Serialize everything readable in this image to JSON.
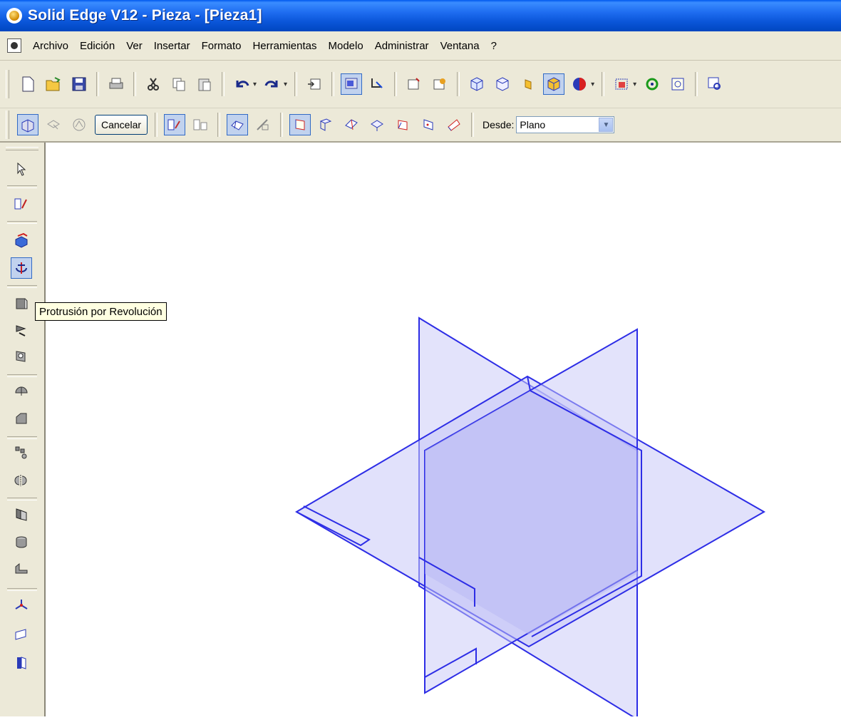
{
  "window": {
    "title": "Solid Edge V12 - Pieza - [Pieza1]"
  },
  "menubar": {
    "items": [
      "Archivo",
      "Edición",
      "Ver",
      "Insertar",
      "Formato",
      "Herramientas",
      "Modelo",
      "Administrar",
      "Ventana",
      "?"
    ]
  },
  "toolbar2": {
    "cancel_label": "Cancelar",
    "desde_label": "Desde:",
    "desde_value": "Plano"
  },
  "tooltip": {
    "text": "Protrusión por Revolución"
  },
  "colors": {
    "plane_stroke": "#2d2de6",
    "plane_fill": "#c8c8f8",
    "titlebar": "#0a55d8",
    "chrome": "#ece9d8"
  },
  "icons": {
    "toolbar1": [
      "new-icon",
      "open-icon",
      "save-icon",
      "print-icon",
      "cut-icon",
      "copy-icon",
      "paste-icon",
      "undo-icon",
      "redo-icon",
      "insert-icon",
      "view-icon",
      "edit-icon",
      "sketch-icon",
      "sketch-color-icon",
      "iso-view-icon",
      "dimetric-view-icon",
      "shaded-icon",
      "shaded-edges-icon",
      "sphere-icon",
      "fit-icon",
      "rotate-icon",
      "zoom-area-icon",
      "zoom-icon"
    ],
    "toolbar2": [
      "select-plane-icon",
      "plane-icon",
      "profile-icon",
      "sketch-mode-icon",
      "sketch-edit-icon",
      "step-icon",
      "step2-icon",
      "plane-coincident-icon",
      "plane-parallel-icon",
      "plane-angle-icon",
      "plane-perpendicular-icon",
      "plane-tangent-icon",
      "plane-3pt-icon",
      "plane-curve-icon"
    ],
    "leftbar": [
      "select-arrow-icon",
      "sketch-icon",
      "extrude-protrusion-icon",
      "revolved-protrusion-icon",
      "cutout-icon",
      "revolved-cutout-icon",
      "hole-icon",
      "round-icon",
      "chamfer-icon",
      "pattern-icon",
      "mirror-icon",
      "thin-wall-icon",
      "rib-icon",
      "lip-icon",
      "coordinate-icon",
      "ref-plane-icon",
      "part-copy-icon"
    ]
  }
}
